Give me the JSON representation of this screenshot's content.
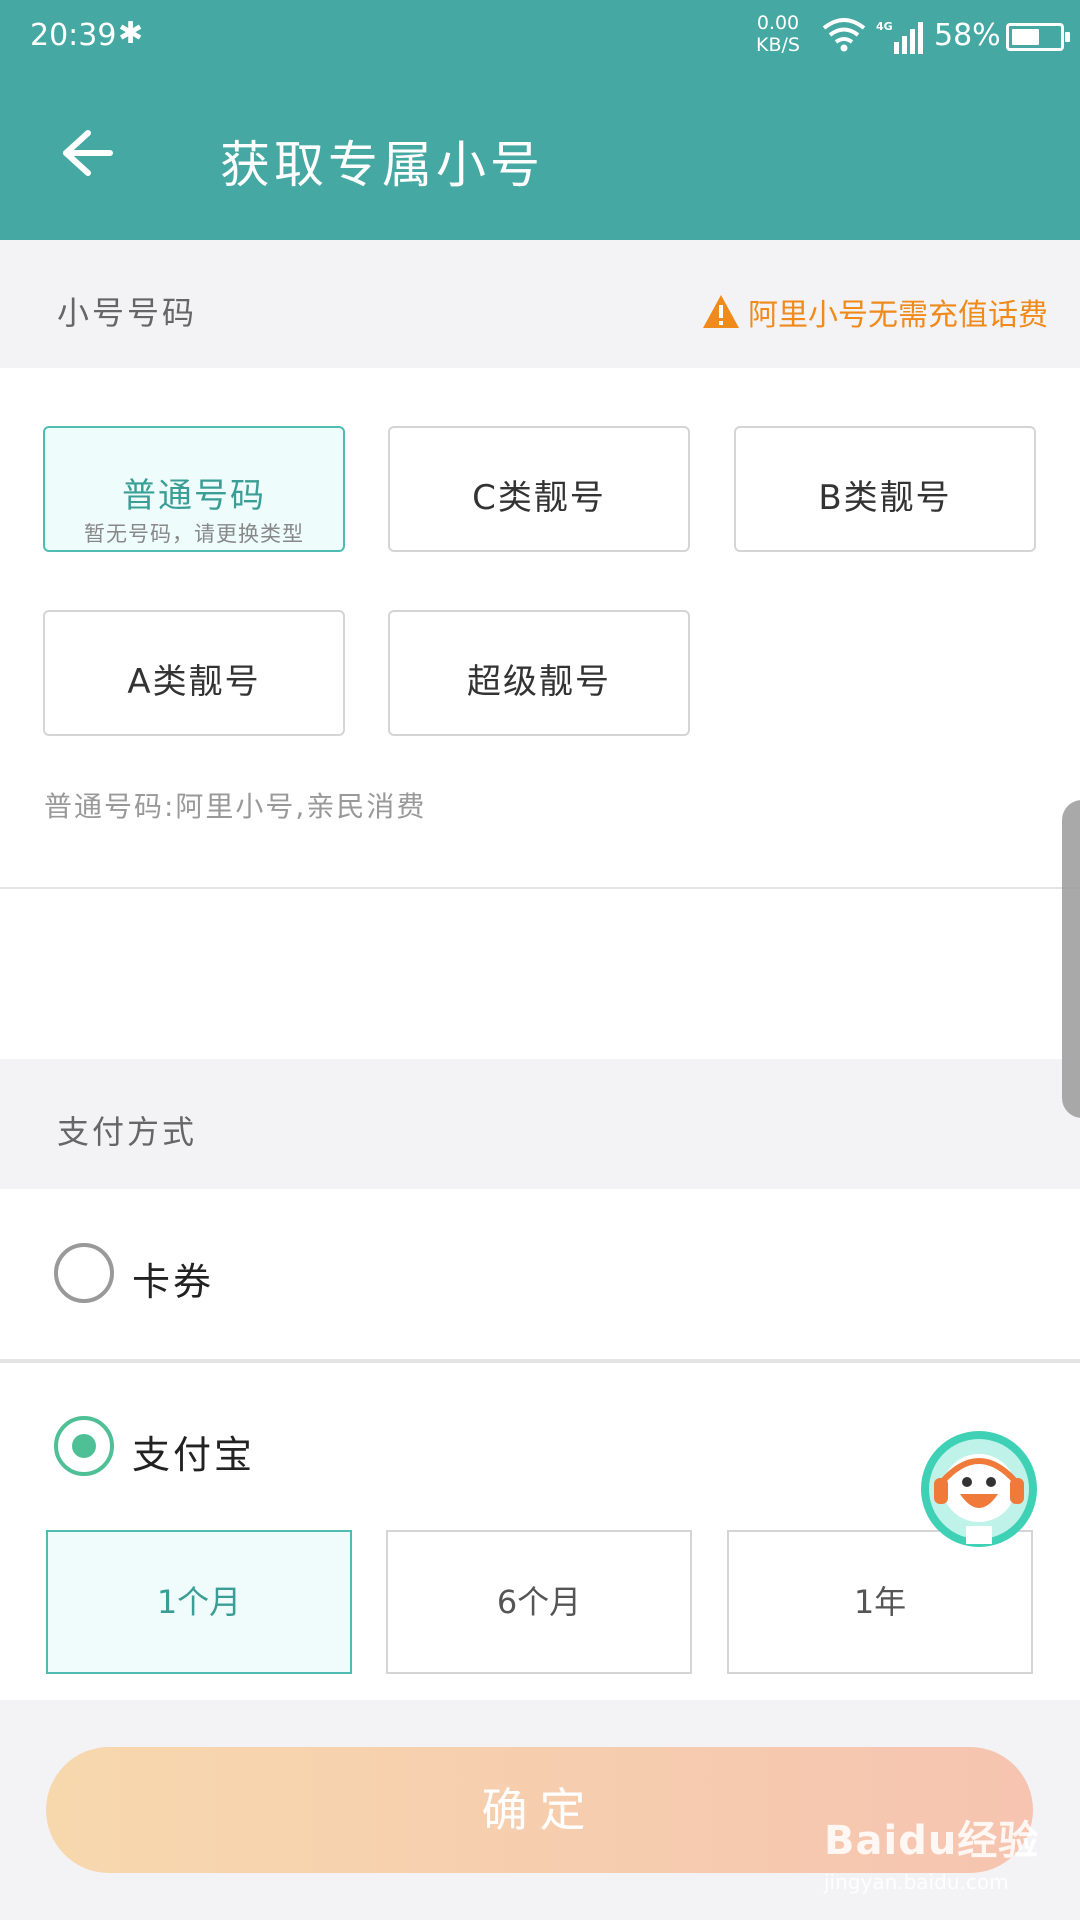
{
  "status": {
    "time": "20:39",
    "net_speed_value": "0.00",
    "net_speed_unit": "KB/S",
    "network_type": "4G",
    "battery": "58%",
    "battery_level": 0.58
  },
  "header": {
    "title": "获取专属小号"
  },
  "number_section": {
    "label": "小号号码",
    "warning": "阿里小号无需充值话费",
    "options": [
      {
        "label": "普通号码",
        "sub": "暂无号码，请更换类型",
        "selected": true
      },
      {
        "label": "C类靓号"
      },
      {
        "label": "B类靓号"
      },
      {
        "label": "A类靓号"
      },
      {
        "label": "超级靓号"
      }
    ],
    "description": "普通号码:阿里小号,亲民消费"
  },
  "payment_section": {
    "label": "支付方式",
    "methods": [
      {
        "label": "卡券",
        "selected": false
      },
      {
        "label": "支付宝",
        "selected": true
      }
    ],
    "periods": [
      {
        "label": "1个月",
        "selected": true
      },
      {
        "label": "6个月"
      },
      {
        "label": "1年"
      }
    ]
  },
  "confirm_label": "确定",
  "watermark": {
    "line1": "Baidu经验",
    "line2": "jingyan.baidu.com"
  },
  "colors": {
    "header": "#46a8a2",
    "accent": "#4fbcb2",
    "warning": "#f08a1b",
    "confirm_gradient_start": "#f7d8ad",
    "confirm_gradient_end": "#f6c4b0"
  }
}
